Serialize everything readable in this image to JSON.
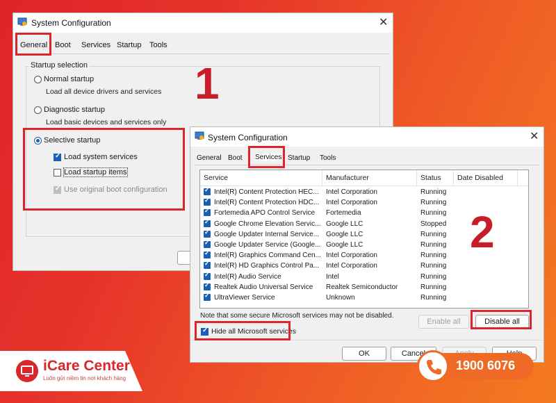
{
  "window1": {
    "title": "System Configuration",
    "close": "✕",
    "tabs": [
      "General",
      "Boot",
      "Services",
      "Startup",
      "Tools"
    ],
    "group_title": "Startup selection",
    "normal_label": "Normal startup",
    "normal_desc": "Load all device drivers and services",
    "diagnostic_label": "Diagnostic startup",
    "diagnostic_desc": "Load basic devices and services only",
    "selective_label": "Selective startup",
    "load_system_services": "Load system services",
    "load_startup_items": "Load startup items",
    "use_original_boot": "Use original boot configuration",
    "annotation_number": "1"
  },
  "window2": {
    "title": "System Configuration",
    "close": "✕",
    "tabs": [
      "General",
      "Boot",
      "Services",
      "Startup",
      "Tools"
    ],
    "columns": [
      "Service",
      "Manufacturer",
      "Status",
      "Date Disabled"
    ],
    "rows": [
      {
        "service": "Intel(R) Content Protection HEC...",
        "manufacturer": "Intel Corporation",
        "status": "Running"
      },
      {
        "service": "Intel(R) Content Protection HDC...",
        "manufacturer": "Intel Corporation",
        "status": "Running"
      },
      {
        "service": "Fortemedia APO Control Service",
        "manufacturer": "Fortemedia",
        "status": "Running"
      },
      {
        "service": "Google Chrome Elevation Servic...",
        "manufacturer": "Google LLC",
        "status": "Stopped"
      },
      {
        "service": "Google Updater Internal Service...",
        "manufacturer": "Google LLC",
        "status": "Running"
      },
      {
        "service": "Google Updater Service (Google...",
        "manufacturer": "Google LLC",
        "status": "Running"
      },
      {
        "service": "Intel(R) Graphics Command Cen...",
        "manufacturer": "Intel Corporation",
        "status": "Running"
      },
      {
        "service": "Intel(R) HD Graphics Control Pa...",
        "manufacturer": "Intel Corporation",
        "status": "Running"
      },
      {
        "service": "Intel(R) Audio Service",
        "manufacturer": "Intel",
        "status": "Running"
      },
      {
        "service": "Realtek Audio Universal Service",
        "manufacturer": "Realtek Semiconductor",
        "status": "Running"
      },
      {
        "service": "UltraViewer Service",
        "manufacturer": "Unknown",
        "status": "Running"
      }
    ],
    "note": "Note that some secure Microsoft services may not be disabled.",
    "enable_all": "Enable all",
    "disable_all": "Disable all",
    "hide_ms": "Hide all Microsoft services",
    "ok": "OK",
    "cancel": "Cancel",
    "apply": "Apply",
    "help": "Help",
    "annotation_number": "2"
  },
  "brand": {
    "name": "iCare Center",
    "tagline": "Luôn gửi niềm tin nơi khách hàng",
    "phone": "1900 6076",
    "colors": {
      "red": "#d9262c",
      "orange": "#ef6a26",
      "accent_blue": "#1a5fb4"
    }
  }
}
